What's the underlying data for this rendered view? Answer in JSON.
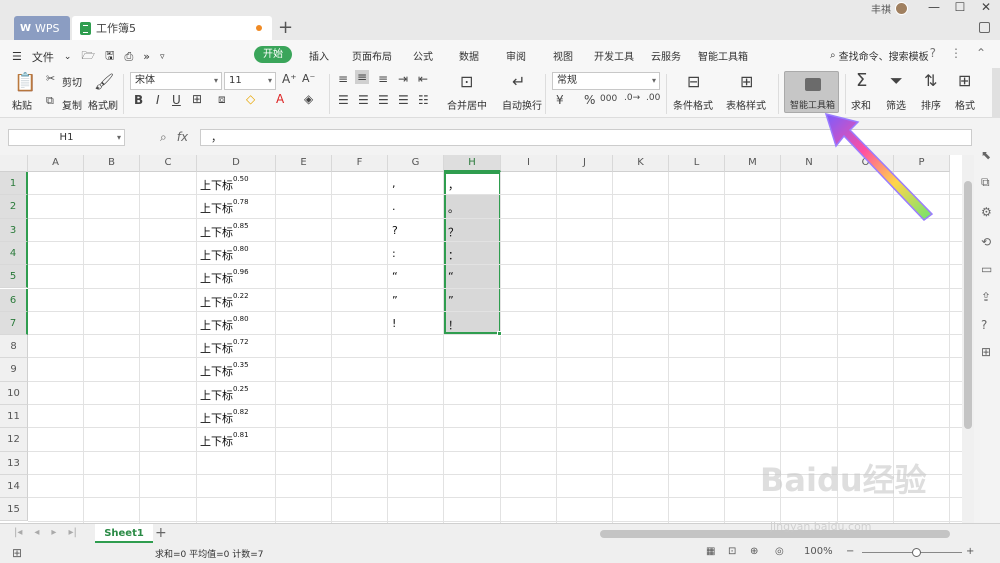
{
  "titlebar": {
    "wps_tab": "WPS",
    "doc_tab": "工作簿5",
    "user_name": "丰祺"
  },
  "menubar": {
    "file": "文件",
    "items": [
      "开始",
      "插入",
      "页面布局",
      "公式",
      "数据",
      "审阅",
      "视图",
      "开发工具",
      "云服务",
      "智能工具箱"
    ],
    "search": "查找命令、搜索模板"
  },
  "ribbon": {
    "paste": "粘贴",
    "cut": "剪切",
    "copy": "复制",
    "format_painter": "格式刷",
    "font_name": "宋体",
    "font_size": "11",
    "merge_center": "合并居中",
    "wrap_text": "自动换行",
    "number_format": "常规",
    "conditional_format": "条件格式",
    "table_style": "表格样式",
    "smart_toolbox": "智能工具箱",
    "sum": "求和",
    "filter": "筛选",
    "sort": "排序",
    "format": "格式"
  },
  "formula_bar": {
    "cell_ref": "H1",
    "fx": "fx",
    "value": "，"
  },
  "grid": {
    "columns": [
      "A",
      "B",
      "C",
      "D",
      "E",
      "F",
      "G",
      "H",
      "I",
      "J",
      "K",
      "L",
      "M",
      "N",
      "O",
      "P"
    ],
    "rows": [
      "1",
      "2",
      "3",
      "4",
      "5",
      "6",
      "7",
      "8",
      "9",
      "10",
      "11",
      "12",
      "13",
      "14",
      "15"
    ],
    "col_d_text": "上下标",
    "col_d_sup": [
      "0.50",
      "0.78",
      "0.85",
      "0.80",
      "0.96",
      "0.22",
      "0.80",
      "0.72",
      "0.35",
      "0.25",
      "0.82",
      "0.81"
    ],
    "col_g": [
      ",",
      ".",
      "?",
      ":",
      "“",
      "”",
      "!"
    ],
    "col_h": [
      "，",
      "。",
      "？",
      "：",
      "“",
      "”",
      "！"
    ]
  },
  "sheets": {
    "tabs": [
      "Sheet1"
    ]
  },
  "status": {
    "text": "求和=0  平均值=0  计数=7",
    "zoom": "100%"
  },
  "watermark": "Baidu经验",
  "watermark_url": "jingyan.baidu.com",
  "colors": {
    "accent": "#2f9d4f",
    "selection_fill": "#d8d8d8"
  }
}
